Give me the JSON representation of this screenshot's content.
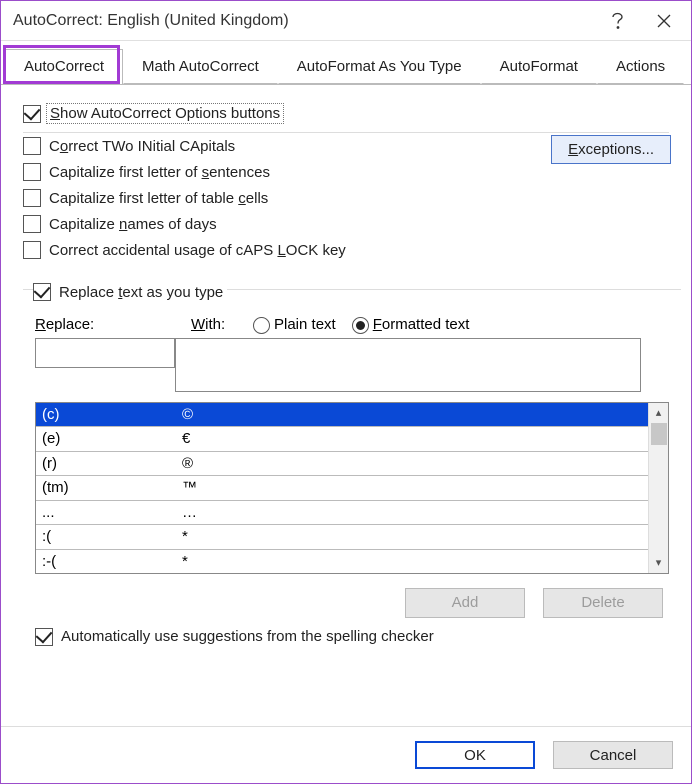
{
  "window": {
    "title": "AutoCorrect: English (United Kingdom)"
  },
  "tabs": [
    "AutoCorrect",
    "Math AutoCorrect",
    "AutoFormat As You Type",
    "AutoFormat",
    "Actions"
  ],
  "active_tab": 0,
  "options": {
    "show_buttons": {
      "label_pre": "",
      "accel": "S",
      "label": "how AutoCorrect Options buttons",
      "checked": true
    },
    "two_caps": {
      "label_pre": "C",
      "accel": "o",
      "label": "rrect TWo INitial CApitals",
      "checked": false
    },
    "cap_sentence": {
      "label_pre": "Capitalize first letter of ",
      "accel": "s",
      "label": "entences",
      "checked": false
    },
    "cap_cells": {
      "label_pre": "Capitalize first letter of table ",
      "accel": "c",
      "label": "ells",
      "checked": false
    },
    "cap_days": {
      "label_pre": "Capitalize ",
      "accel": "n",
      "label": "ames of days",
      "checked": false
    },
    "caps_lock": {
      "label_pre": "Correct accidental usage of cAPS ",
      "accel": "L",
      "label": "OCK key",
      "checked": false
    },
    "replace_as_type": {
      "label_pre": "Replace ",
      "accel": "t",
      "label": "ext as you type",
      "checked": true
    },
    "auto_suggest": {
      "label_pre": "Automatically use su",
      "accel": "g",
      "label": "gestions from the spelling checker",
      "checked": true
    }
  },
  "exceptions_label": "Exceptions...",
  "replace_label_pre": "",
  "replace_accel": "R",
  "replace_label": "eplace:",
  "with_accel": "W",
  "with_label": "ith:",
  "radio": {
    "plain": "Plain text",
    "formatted": "Formatted text",
    "selected": "formatted"
  },
  "replace_input": "",
  "with_input": "",
  "rows": [
    {
      "k": "(c)",
      "v": "©",
      "selected": true
    },
    {
      "k": "(e)",
      "v": "€",
      "selected": false
    },
    {
      "k": "(r)",
      "v": "®",
      "selected": false
    },
    {
      "k": "(tm)",
      "v": "™",
      "selected": false
    },
    {
      "k": "...",
      "v": "…",
      "selected": false
    },
    {
      "k": ":(",
      "v": "*",
      "selected": false
    },
    {
      "k": ":-(",
      "v": "*",
      "selected": false
    }
  ],
  "buttons": {
    "add": "Add",
    "delete": "Delete",
    "ok": "OK",
    "cancel": "Cancel"
  }
}
